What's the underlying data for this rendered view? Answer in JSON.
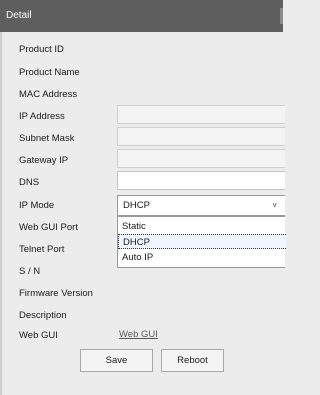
{
  "title": "Detail",
  "labels": {
    "product_id": "Product ID",
    "product_name": "Product Name",
    "mac_address": "MAC Address",
    "ip_address": "IP Address",
    "subnet_mask": "Subnet Mask",
    "gateway_ip": "Gateway IP",
    "dns": "DNS",
    "ip_mode": "IP Mode",
    "web_gui_port": "Web GUI Port",
    "telnet_port": "Telnet Port",
    "sn": "S / N",
    "firmware_version": "Firmware Version",
    "description": "Description",
    "web_gui": "Web GUI"
  },
  "ip_mode": {
    "selected": "DHCP",
    "options": [
      "Static",
      "DHCP",
      "Auto IP"
    ]
  },
  "web_gui_link": "Web GUI",
  "buttons": {
    "save": "Save",
    "reboot": "Reboot"
  },
  "colors": {
    "titlebar": "#5e5e5e",
    "panel": "#ececec",
    "link": "#5a5a5a"
  }
}
